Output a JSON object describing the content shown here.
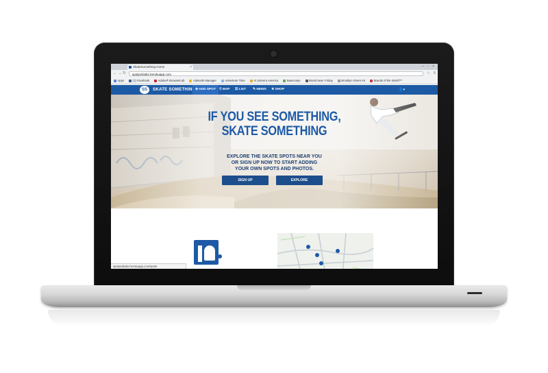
{
  "browser": {
    "tab_title": "SkateSomething Home",
    "tab_close": "×",
    "window_buttons": "– ▫ ×",
    "nav": {
      "back": "←",
      "forward": "→",
      "reload": "↻"
    },
    "url": "spotjocklabs.herokuapp.com",
    "star": "☆",
    "menu": "≡",
    "bookmarks": [
      "Apps",
      "(1) Facebook",
      "Adobe® BrowserLab",
      "Adwords Manager",
      "Adventure Time",
      "Al Jazeera America",
      "Basecamp",
      "Brand New: Friday",
      "Brooklyn Street Art",
      "Brands of the World™"
    ],
    "status_url": "spotjocklabs.herokuapp.com/spots"
  },
  "site": {
    "logo_text": "SS",
    "brand": "SKATE SOMETHING",
    "nav": {
      "add_spot": "⊕ ADD SPOT",
      "map": "⚲ MAP",
      "list": "☰ LIST",
      "news": "✎ NEWS",
      "shop": "★ SHOP",
      "user": "👤▾"
    },
    "hero": {
      "headline_1": "IF YOU SEE SOMETHING,",
      "headline_2": "SKATE SOMETHING",
      "sub_1": "EXPLORE THE SKATE SPOTS NEAR YOU",
      "sub_2": "OR SIGN UP NOW TO START ADDING",
      "sub_3": "YOUR OWN SPOTS AND PHOTOS.",
      "signup": "SIGN UP",
      "explore": "EXPLORE"
    }
  },
  "colors": {
    "brand_blue": "#1d5aa5",
    "button_blue": "#1d4e8c",
    "hero_bg": "#ddd4c6"
  },
  "icons": [
    "camera-icon",
    "star-icon",
    "menu-icon",
    "logo-icon",
    "user-icon",
    "spot-icon",
    "map-pin-icon"
  ]
}
